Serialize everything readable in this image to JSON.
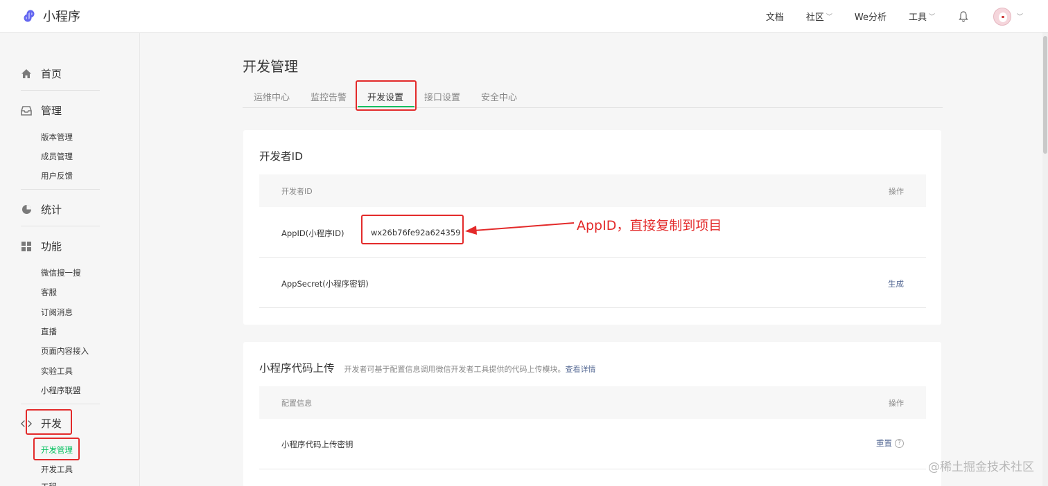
{
  "app": {
    "name": "小程序"
  },
  "topnav": {
    "items": [
      {
        "label": "文档",
        "dropdown": false
      },
      {
        "label": "社区",
        "dropdown": true
      },
      {
        "label": "We分析",
        "dropdown": false
      },
      {
        "label": "工具",
        "dropdown": true
      }
    ],
    "icons": [
      "bell-icon",
      "avatar"
    ]
  },
  "sidebar": {
    "home": "首页",
    "manage": {
      "label": "管理",
      "items": [
        "版本管理",
        "成员管理",
        "用户反馈"
      ]
    },
    "stats": "统计",
    "features": {
      "label": "功能",
      "items": [
        "微信搜一搜",
        "客服",
        "订阅消息",
        "直播",
        "页面内容接入",
        "实验工具",
        "小程序联盟"
      ]
    },
    "dev": {
      "label": "开发",
      "items": [
        "开发管理",
        "开发工具",
        "工程..."
      ]
    },
    "active_item": "开发管理"
  },
  "main": {
    "title": "开发管理",
    "tabs": [
      "运维中心",
      "监控告警",
      "开发设置",
      "接口设置",
      "安全中心"
    ],
    "active_tab": "开发设置"
  },
  "dev_id_card": {
    "title": "开发者ID",
    "col_left": "开发者ID",
    "col_right": "操作",
    "appid_label": "AppID(小程序ID)",
    "appid_value": "wx26b76fe92a624359",
    "secret_label": "AppSecret(小程序密钥)",
    "secret_action": "生成"
  },
  "upload_card": {
    "title": "小程序代码上传",
    "desc": "开发者可基于配置信息调用微信开发者工具提供的代码上传模块。",
    "desc_link": "查看详情",
    "col_left": "配置信息",
    "col_right": "操作",
    "key_label": "小程序代码上传密钥",
    "key_action": "重置",
    "help": "?"
  },
  "annotation": {
    "text": "AppID，直接复制到项目",
    "color": "#e32a2a"
  },
  "watermark": "@稀土掘金技术社区",
  "colors": {
    "accent": "#07c160",
    "link": "#576b95",
    "annotation": "#e32a2a"
  }
}
